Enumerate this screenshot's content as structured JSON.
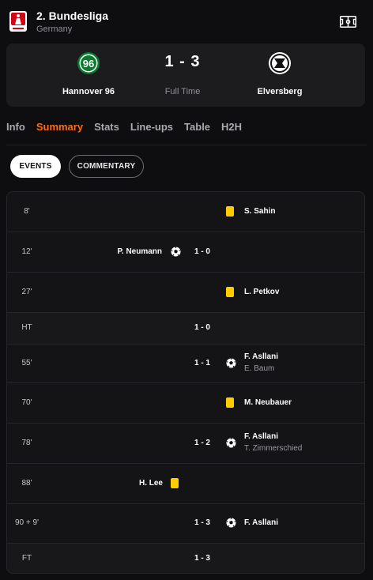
{
  "league": {
    "name": "2. Bundesliga",
    "country": "Germany"
  },
  "match": {
    "home": "Hannover 96",
    "away": "Elversberg",
    "score": "1 - 3",
    "status": "Full Time"
  },
  "tabs": [
    "Info",
    "Summary",
    "Stats",
    "Line-ups",
    "Table",
    "H2H"
  ],
  "active_tab": "Summary",
  "pills": {
    "events": "EVENTS",
    "commentary": "COMMENTARY"
  },
  "events": [
    {
      "minute": "8'",
      "type": "yellow-card",
      "side": "away",
      "player": "S. Sahin"
    },
    {
      "minute": "12'",
      "type": "goal",
      "side": "home",
      "player": "P. Neumann",
      "score": "1 - 0"
    },
    {
      "minute": "27'",
      "type": "yellow-card",
      "side": "away",
      "player": "L. Petkov"
    },
    {
      "minute": "HT",
      "type": "period",
      "score": "1 - 0"
    },
    {
      "minute": "55'",
      "type": "goal",
      "side": "away",
      "player": "F. Asllani",
      "assist": "E. Baum",
      "score": "1 - 1"
    },
    {
      "minute": "70'",
      "type": "yellow-card",
      "side": "away",
      "player": "M. Neubauer"
    },
    {
      "minute": "78'",
      "type": "goal",
      "side": "away",
      "player": "F. Asllani",
      "assist": "T. Zimmerschied",
      "score": "1 - 2"
    },
    {
      "minute": "88'",
      "type": "yellow-card",
      "side": "home",
      "player": "H. Lee"
    },
    {
      "minute": "90 + 9'",
      "type": "goal",
      "side": "away",
      "player": "F. Asllani",
      "score": "1 - 3"
    },
    {
      "minute": "FT",
      "type": "period",
      "score": "1 - 3"
    }
  ],
  "colors": {
    "accent": "#ff6a13",
    "yellow_card": "#ffcc00",
    "background": "#0e0e10",
    "card_bg": "#1c1c1f"
  }
}
